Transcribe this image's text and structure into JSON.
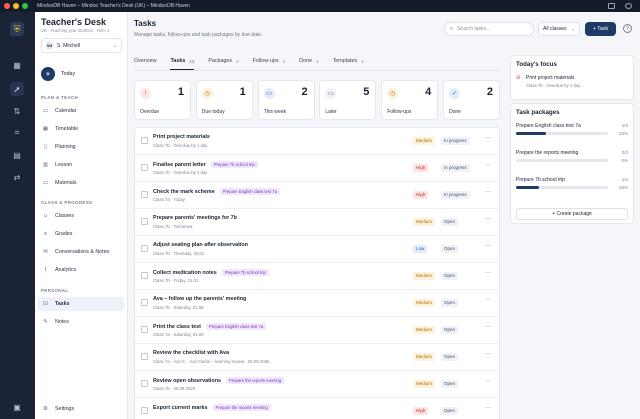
{
  "window": {
    "title": "MindooDB Haven – Mindoo Teacher's Desk (UK) – MindooDB Haven"
  },
  "app": {
    "name": "Teacher's Desk",
    "subtitle": "UK · Teaching year 2025/26 · Term 1"
  },
  "user": {
    "initials": "SM",
    "name": "S. Mitchell"
  },
  "sidebar": {
    "today_label": "Today",
    "plan_title": "PLAN & TEACH",
    "plan_items": [
      {
        "label": "Calendar",
        "icon": "calendar-icon"
      },
      {
        "label": "Timetable",
        "icon": "table-icon"
      },
      {
        "label": "Planning",
        "icon": "clipboard-icon"
      },
      {
        "label": "Lesson",
        "icon": "book-icon"
      },
      {
        "label": "Materials",
        "icon": "folder-icon"
      }
    ],
    "class_title": "CLASS & PROGRESS",
    "class_items": [
      {
        "label": "Classes",
        "icon": "users-icon"
      },
      {
        "label": "Grades",
        "icon": "grade-icon"
      },
      {
        "label": "Conversations & Notes",
        "icon": "chat-icon"
      },
      {
        "label": "Analytics",
        "icon": "chart-icon"
      }
    ],
    "personal_title": "PERSONAL",
    "personal_items": [
      {
        "label": "Tasks",
        "icon": "check-icon"
      },
      {
        "label": "Notes",
        "icon": "note-icon"
      }
    ],
    "settings_label": "Settings"
  },
  "header": {
    "title": "Tasks",
    "subtitle": "Manage tasks, follow-ups and task packages by due date.",
    "search_placeholder": "Search tasks...",
    "class_filter": "All classes",
    "add_label": "+ Task"
  },
  "tabs": [
    {
      "label": "Overview",
      "count": ""
    },
    {
      "label": "Tasks",
      "count": "13"
    },
    {
      "label": "Packages",
      "count": "3"
    },
    {
      "label": "Follow-ups",
      "count": "4"
    },
    {
      "label": "Done",
      "count": "2"
    },
    {
      "label": "Templates",
      "count": "3"
    }
  ],
  "summary_cards": [
    {
      "label": "Overdue",
      "count": "1",
      "color": "#d23b3b",
      "bg": "#fde8e8",
      "icon": "alert-icon"
    },
    {
      "label": "Due today",
      "count": "1",
      "color": "#c77a00",
      "bg": "#fdf1dc",
      "icon": "clock-icon"
    },
    {
      "label": "This week",
      "count": "2",
      "color": "#2f5fb3",
      "bg": "#e3ecfb",
      "icon": "calendar-icon"
    },
    {
      "label": "Later",
      "count": "5",
      "color": "#5e6778",
      "bg": "#eef1f5",
      "icon": "calendar-icon"
    },
    {
      "label": "Follow-ups",
      "count": "4",
      "color": "#c77a00",
      "bg": "#fdf1dc",
      "icon": "clock-icon"
    },
    {
      "label": "Done",
      "count": "2",
      "color": "#2f5fb3",
      "bg": "#e3ecfb",
      "icon": "check-icon"
    }
  ],
  "tasks": [
    {
      "title": "Print project materials",
      "tag": "",
      "meta": "Class 7b · Overdue by 1 day",
      "priority": "Medium",
      "status": "In progress"
    },
    {
      "title": "Finalise parent letter",
      "tag": "Prepare 7b school trip",
      "meta": "Class 7b · Overdue by 1 day",
      "priority": "High",
      "status": "In progress"
    },
    {
      "title": "Check the mark scheme",
      "tag": "Prepare English class test 7a",
      "meta": "Class 7a · Today",
      "priority": "High",
      "status": "In progress"
    },
    {
      "title": "Prepare parents' meetings for 7b",
      "tag": "",
      "meta": "Class 7b · Tomorrow",
      "priority": "Medium",
      "status": "Open"
    },
    {
      "title": "Adjust seating plan after observation",
      "tag": "",
      "meta": "Class 7b · Thursday, 30.01",
      "priority": "Low",
      "status": "Open"
    },
    {
      "title": "Collect medication notes",
      "tag": "Prepare 7b school trip",
      "meta": "Class 7b · Friday, 31.01",
      "priority": "Medium",
      "status": "Open"
    },
    {
      "title": "Ava – follow up the parents' meeting",
      "tag": "",
      "meta": "Class 7b · Saturday, 01.08",
      "priority": "Medium",
      "status": "Open"
    },
    {
      "title": "Print the class test",
      "tag": "Prepare English class test 7a",
      "meta": "Class 7a · Saturday, 01.08",
      "priority": "Medium",
      "status": "Open"
    },
    {
      "title": "Review the checklist with Ava",
      "tag": "",
      "meta": "Class 7a · Ava S. · Ava Clarke – learning review · 05.08.2026",
      "priority": "Medium",
      "status": "Open"
    },
    {
      "title": "Review open observations",
      "tag": "Prepare the reports meeting",
      "meta": "Class 7b · 05.08.2026",
      "priority": "Medium",
      "status": "Open"
    },
    {
      "title": "Export current marks",
      "tag": "Prepare the reports meeting",
      "meta": "",
      "priority": "High",
      "status": "Open"
    }
  ],
  "focus": {
    "title": "Today's focus",
    "item": "Print project materials",
    "meta": "Class 7b · Overdue by 1 day"
  },
  "packages": {
    "title": "Task packages",
    "items": [
      {
        "name": "Prepare English class test 7a",
        "count": "1/3",
        "percent": "33%",
        "progress": 0.33
      },
      {
        "name": "Prepare the reports meeting",
        "count": "0/3",
        "percent": "0%",
        "progress": 0
      },
      {
        "name": "Prepare 7b school trip",
        "count": "1/4",
        "percent": "25%",
        "progress": 0.25
      }
    ],
    "create_label": "+ Create package"
  }
}
